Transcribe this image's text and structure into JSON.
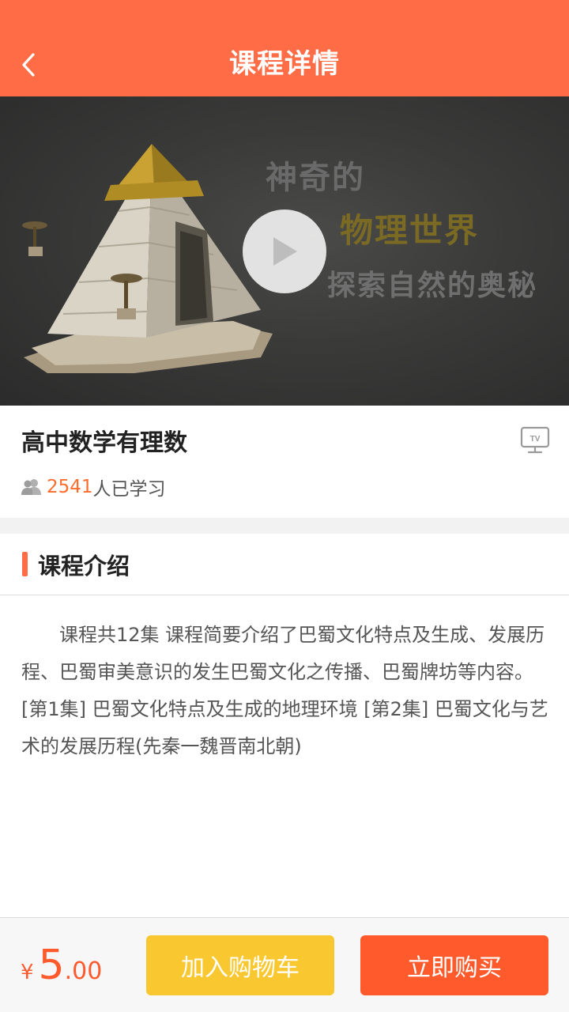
{
  "colors": {
    "accent": "#ff6c45",
    "price": "#ff5a2c",
    "cart_button": "#f9c72f",
    "buy_button": "#ff5a2c"
  },
  "header": {
    "title": "课程详情",
    "back_icon": "chevron-left-icon"
  },
  "video": {
    "thumbnail_lines": [
      "神奇的",
      "物理世界",
      "探索自然的奥秘"
    ],
    "play_icon": "play-icon"
  },
  "course": {
    "title": "高中数学有理数",
    "tv_icon": "tv-icon",
    "tv_label": "TV",
    "learner_icon": "users-icon",
    "learner_count": "2541",
    "learner_suffix": "人已学习"
  },
  "intro": {
    "title": "课程介绍",
    "text": "课程共12集 课程简要介绍了巴蜀文化特点及生成、发展历程、巴蜀审美意识的发生巴蜀文化之传播、巴蜀牌坊等内容。[第1集] 巴蜀文化特点及生成的地理环境 [第2集] 巴蜀文化与艺术的发展历程(先秦一魏晋南北朝)"
  },
  "footer": {
    "currency": "¥",
    "price_int": "5",
    "price_dec": ".00",
    "add_to_cart": "加入购物车",
    "buy_now": "立即购买"
  }
}
